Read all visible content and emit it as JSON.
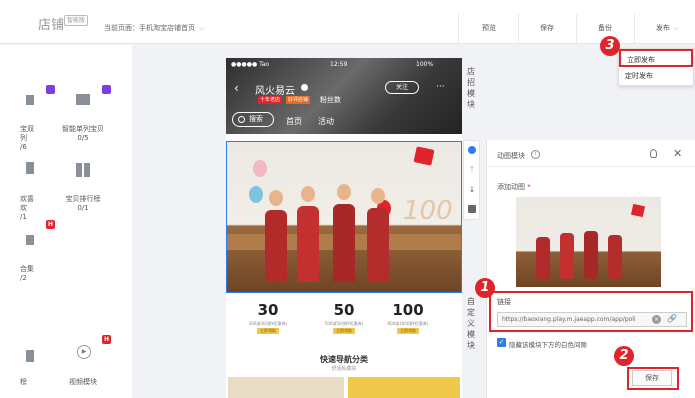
{
  "header": {
    "logo": "店铺",
    "version_tag": "智能版",
    "current_page_label": "当前页面：",
    "current_page_value": "手机淘宝店铺首页",
    "preview": "预览",
    "save": "保存",
    "backup": "备份",
    "publish": "发布"
  },
  "publish_menu": {
    "publish_now": "立即发布",
    "scheduled": "定时发布"
  },
  "sidebar": {
    "widgets": [
      {
        "label": "宝双列",
        "count": "/6"
      },
      {
        "label": "智能单列宝贝",
        "count": "0/5"
      },
      {
        "label": "欢喜欢",
        "count": "/1"
      },
      {
        "label": "宝贝排行榜",
        "count": "0/1"
      },
      {
        "label": "合集",
        "count": "/2"
      },
      {
        "label": "视频模块",
        "count": ""
      },
      {
        "label": "榜",
        "count": ""
      }
    ],
    "badge_h": "H"
  },
  "phone": {
    "carrier": "●●●●● Tao",
    "time": "12:59",
    "battery": "100%",
    "shop_name": "风火易云",
    "tag1": "十年老店",
    "tag2": "好评店铺",
    "fans": "粉丝数",
    "follow": "关注",
    "more": "···",
    "search": "搜索",
    "nav": [
      "首页",
      "活动"
    ],
    "coupons": [
      {
        "value": "30",
        "desc": "300减30(限¥优惠券)",
        "btn": "立即领取"
      },
      {
        "value": "50",
        "desc": "500减50(限¥优惠券)",
        "btn": "立即领取"
      },
      {
        "value": "100",
        "desc": "800减100(限¥优惠券)",
        "btn": "立即领取"
      }
    ],
    "quick_title": "快速导航分类",
    "quick_sub": "舒适私藏夹"
  },
  "rail": {
    "shop_sign": "店招模块",
    "custom": "自定义模块"
  },
  "panel": {
    "title": "动图模块",
    "info": "i",
    "close": "✕",
    "add_image": "添加动图",
    "required": "*",
    "link_label": "链接",
    "link_value": "https://baoxiang.play.m.jaeapp.com/app/poli",
    "hide_gap_label": "隐藏该模块下方的白色间隙",
    "save": "保存"
  },
  "steps": [
    "1",
    "2",
    "3"
  ],
  "colors": {
    "accent_red": "#e0242b",
    "link_blue": "#2b7de9",
    "badge_purple": "#7b3fe4"
  }
}
